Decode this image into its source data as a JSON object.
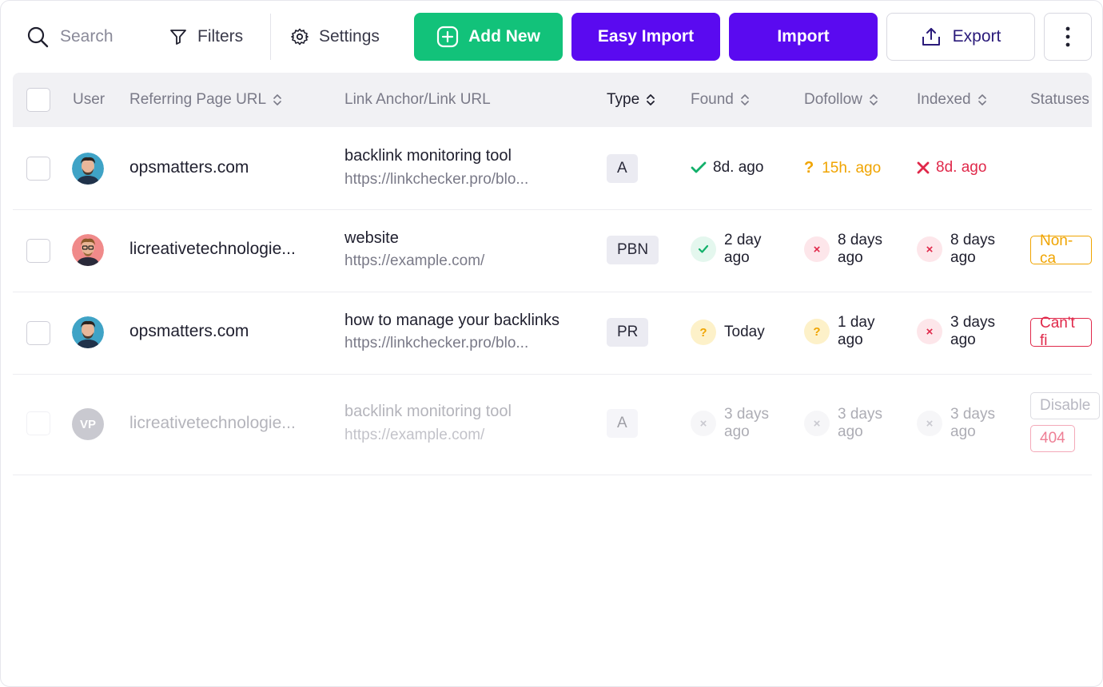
{
  "toolbar": {
    "search_placeholder": "Search",
    "filters_label": "Filters",
    "settings_label": "Settings",
    "add_new_label": "Add New",
    "easy_import_label": "Easy Import",
    "import_label": "Import",
    "export_label": "Export"
  },
  "colors": {
    "green": "#12c27a",
    "purple": "#5a0af0",
    "success": "#12b06a",
    "warning": "#f0a400",
    "danger": "#e0284a"
  },
  "table": {
    "headers": {
      "user": "User",
      "referring_url": "Referring Page URL",
      "anchor": "Link Anchor/Link URL",
      "type": "Type",
      "found": "Found",
      "dofollow": "Dofollow",
      "indexed": "Indexed",
      "statuses": "Statuses"
    },
    "rows": [
      {
        "domain": "opsmatters.com",
        "anchor": "backlink monitoring tool",
        "url": "https://linkchecker.pro/blo...",
        "type": "A",
        "found": {
          "icon": "check-icon",
          "line1": "8d. ago",
          "line2": ""
        },
        "dofollow": {
          "icon": "question-icon",
          "line1": "15h. ago",
          "line2": ""
        },
        "indexed": {
          "icon": "cross-icon",
          "line1": "8d. ago",
          "line2": ""
        },
        "statuses": []
      },
      {
        "domain": "licreativetechnologie...",
        "anchor": "website",
        "url": "https://example.com/",
        "type": "PBN",
        "found": {
          "icon": "check-icon",
          "line1": "2 day",
          "line2": "ago"
        },
        "dofollow": {
          "icon": "cross-icon",
          "line1": "8 days",
          "line2": "ago"
        },
        "indexed": {
          "icon": "cross-icon",
          "line1": "8 days",
          "line2": "ago"
        },
        "statuses": [
          "Non-ca"
        ]
      },
      {
        "domain": "opsmatters.com",
        "anchor": "how to manage your backlinks",
        "url": "https://linkchecker.pro/blo...",
        "type": "PR",
        "found": {
          "icon": "question-icon",
          "line1": "Today",
          "line2": ""
        },
        "dofollow": {
          "icon": "question-icon",
          "line1": "1 day",
          "line2": "ago"
        },
        "indexed": {
          "icon": "cross-icon",
          "line1": "3 days",
          "line2": "ago"
        },
        "statuses": [
          "Can't fi"
        ]
      },
      {
        "domain": "licreativetechnologie...",
        "avatar_initials": "VP",
        "anchor": "backlink monitoring tool",
        "url": "https://example.com/",
        "type": "A",
        "found": {
          "icon": "cross-icon",
          "line1": "3 days",
          "line2": "ago"
        },
        "dofollow": {
          "icon": "cross-icon",
          "line1": "3 days",
          "line2": "ago"
        },
        "indexed": {
          "icon": "cross-icon",
          "line1": "3 days",
          "line2": "ago"
        },
        "statuses": [
          "Disable",
          "404"
        ]
      }
    ]
  }
}
